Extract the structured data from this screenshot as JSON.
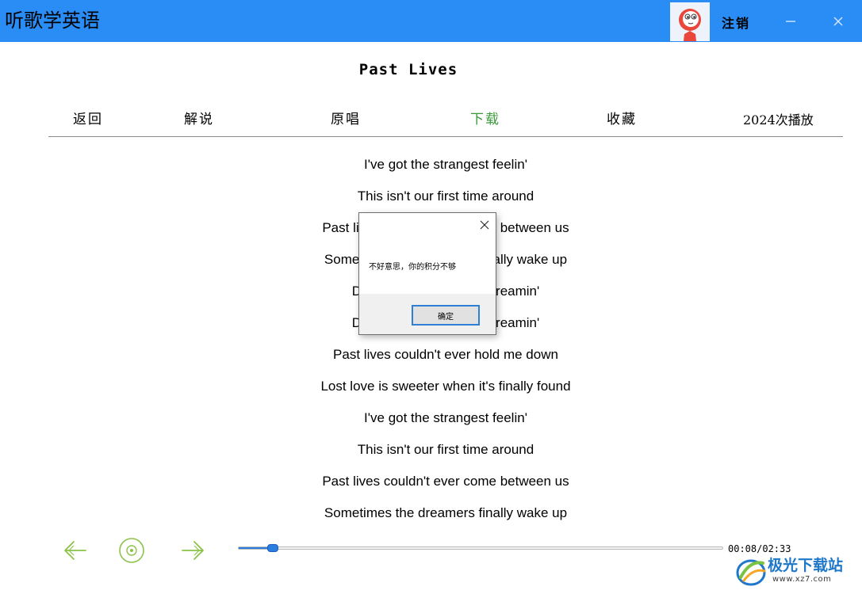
{
  "window": {
    "title": "听歌学英语",
    "logout_label": "注销",
    "minimize_icon": "minimize-icon",
    "close_icon": "close-icon"
  },
  "song": {
    "title": "Past Lives"
  },
  "nav": {
    "back": "返回",
    "explain": "解说",
    "original": "原唱",
    "download": "下载",
    "favorite": "收藏",
    "play_count": "2024次播放"
  },
  "lyrics": [
    "I've got the strangest feelin'",
    "This isn't our first time around",
    "Past lives couldn't ever come between us",
    "Sometimes the dreamers finally wake up",
    "Don't wake me I'm not dreamin'",
    "Don't wake me I'm not dreamin'",
    "Past lives couldn't ever hold me down",
    "Lost love is sweeter when it's finally found",
    "I've got the strangest feelin'",
    "This isn't our first time around",
    "Past lives couldn't ever come between us",
    "Sometimes the dreamers finally wake up"
  ],
  "player": {
    "elapsed": "00:08",
    "duration": "02:33",
    "time_display": "00:08/02:33",
    "progress_fraction": 0.0686,
    "accent_color": "#2a7de1",
    "control_color": "#8bc34a",
    "icons": [
      "arrow-left-icon",
      "play-circle-icon",
      "arrow-right-icon"
    ]
  },
  "dialog": {
    "message": "不好意思，你的积分不够",
    "ok_label": "确定"
  },
  "watermark": {
    "brand": "极光下载站",
    "url": "www.xz7.com"
  },
  "colors": {
    "titlebar": "#2a8df5",
    "active_nav": "#3a9a3a"
  }
}
